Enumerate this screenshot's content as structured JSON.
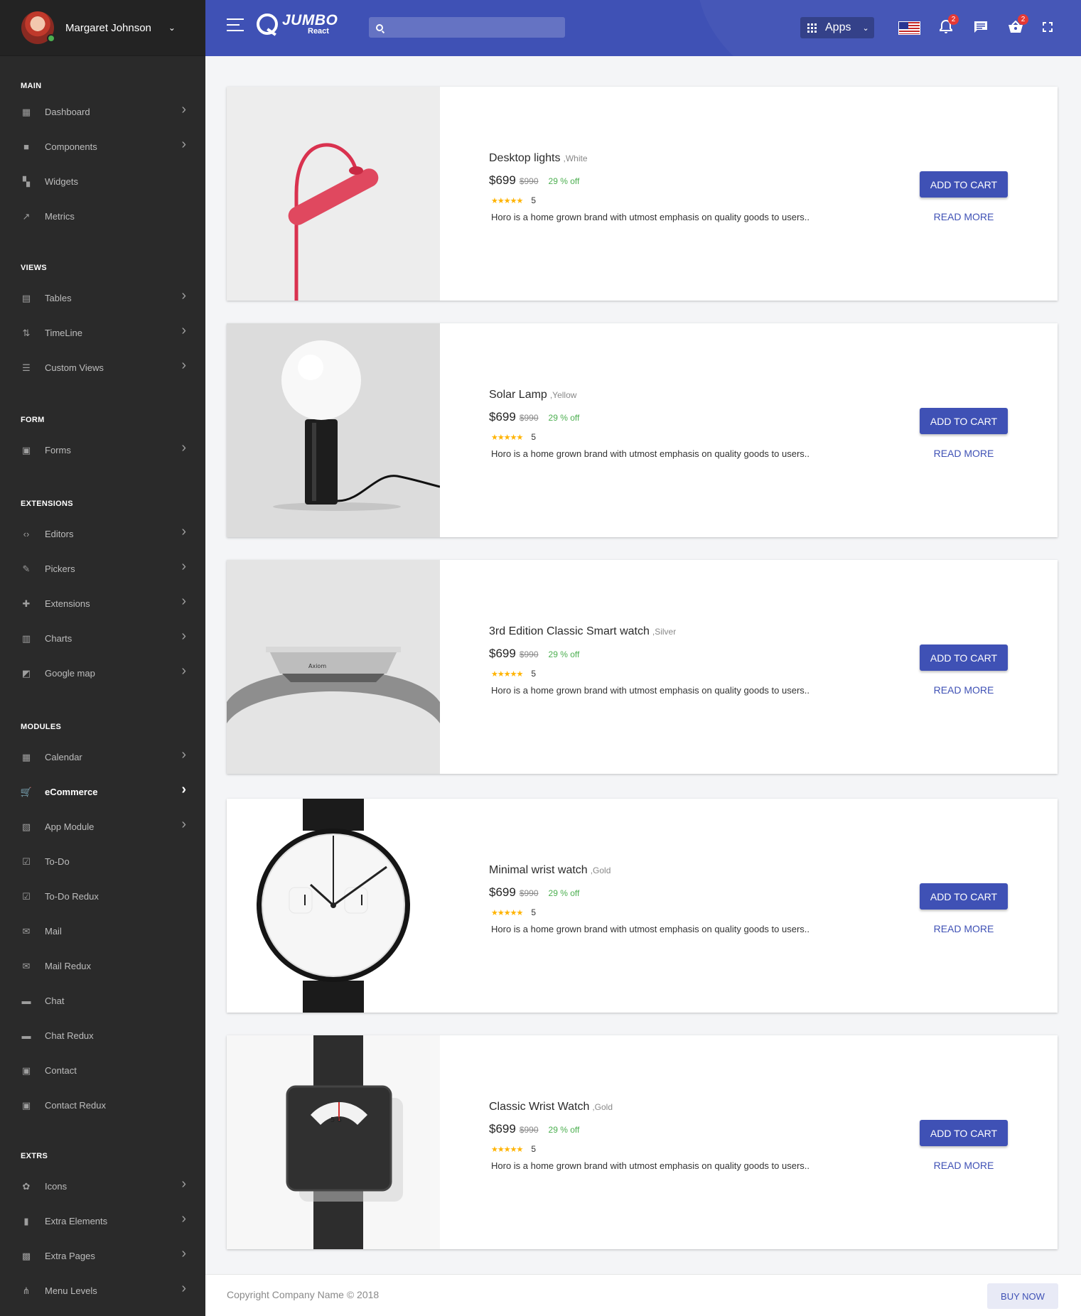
{
  "user": {
    "name": "Margaret Johnson"
  },
  "brand": {
    "name": "JUMBO",
    "sub": "React"
  },
  "search": {
    "placeholder": ""
  },
  "header": {
    "apps_label": "Apps",
    "notifications_count": "2",
    "cart_count": "2"
  },
  "sidebar": {
    "sections": [
      {
        "title": "MAIN",
        "items": [
          {
            "label": "Dashboard",
            "icon": "dashboard-icon",
            "arrow": true
          },
          {
            "label": "Components",
            "icon": "folder-icon",
            "arrow": true
          },
          {
            "label": "Widgets",
            "icon": "widgets-icon",
            "arrow": false
          },
          {
            "label": "Metrics",
            "icon": "trending-icon",
            "arrow": false
          }
        ]
      },
      {
        "title": "VIEWS",
        "items": [
          {
            "label": "Tables",
            "icon": "table-icon",
            "arrow": true
          },
          {
            "label": "TimeLine",
            "icon": "timeline-icon",
            "arrow": true
          },
          {
            "label": "Custom Views",
            "icon": "list-icon",
            "arrow": true
          }
        ]
      },
      {
        "title": "FORM",
        "items": [
          {
            "label": "Forms",
            "icon": "form-icon",
            "arrow": true
          }
        ]
      },
      {
        "title": "EXTENSIONS",
        "items": [
          {
            "label": "Editors",
            "icon": "code-icon",
            "arrow": true
          },
          {
            "label": "Pickers",
            "icon": "brush-icon",
            "arrow": true
          },
          {
            "label": "Extensions",
            "icon": "puzzle-icon",
            "arrow": true
          },
          {
            "label": "Charts",
            "icon": "chart-icon",
            "arrow": true
          },
          {
            "label": "Google map",
            "icon": "map-icon",
            "arrow": true
          }
        ]
      },
      {
        "title": "MODULES",
        "items": [
          {
            "label": "Calendar",
            "icon": "calendar-icon",
            "arrow": true
          },
          {
            "label": "eCommerce",
            "icon": "cart-icon",
            "arrow": true,
            "active": true
          },
          {
            "label": "App Module",
            "icon": "app-module-icon",
            "arrow": true
          },
          {
            "label": "To-Do",
            "icon": "checkbox-icon",
            "arrow": false
          },
          {
            "label": "To-Do Redux",
            "icon": "checkbox-icon",
            "arrow": false
          },
          {
            "label": "Mail",
            "icon": "mail-icon",
            "arrow": false
          },
          {
            "label": "Mail Redux",
            "icon": "mail-icon",
            "arrow": false
          },
          {
            "label": "Chat",
            "icon": "chat-icon",
            "arrow": false
          },
          {
            "label": "Chat Redux",
            "icon": "chat-icon",
            "arrow": false
          },
          {
            "label": "Contact",
            "icon": "contact-icon",
            "arrow": false
          },
          {
            "label": "Contact Redux",
            "icon": "contact-icon",
            "arrow": false
          }
        ]
      },
      {
        "title": "EXTRS",
        "items": [
          {
            "label": "Icons",
            "icon": "icons-icon",
            "arrow": true
          },
          {
            "label": "Extra Elements",
            "icon": "elements-icon",
            "arrow": true
          },
          {
            "label": "Extra Pages",
            "icon": "pages-icon",
            "arrow": true
          },
          {
            "label": "Menu Levels",
            "icon": "menu-levels-icon",
            "arrow": true
          }
        ]
      }
    ]
  },
  "products": [
    {
      "name": "Desktop lights",
      "variant": ",White",
      "price": "$699",
      "old_price": "$990",
      "discount": "29 % off",
      "stars": "★★★★★",
      "rating": "5",
      "description": "Horo is a home grown brand with utmost emphasis on quality goods to users..",
      "image": "desk-lamp",
      "add_label": "ADD TO CART",
      "read_label": "READ MORE"
    },
    {
      "name": "Solar Lamp",
      "variant": ",Yellow",
      "price": "$699",
      "old_price": "$990",
      "discount": "29 % off",
      "stars": "★★★★★",
      "rating": "5",
      "description": "Horo is a home grown brand with utmost emphasis on quality goods to users..",
      "image": "solar-lamp",
      "add_label": "ADD TO CART",
      "read_label": "READ MORE"
    },
    {
      "name": "3rd Edition Classic Smart watch",
      "variant": ",Silver",
      "price": "$699",
      "old_price": "$990",
      "discount": "29 % off",
      "stars": "★★★★★",
      "rating": "5",
      "description": "Horo is a home grown brand with utmost emphasis on quality goods to users..",
      "image": "smart-watch",
      "add_label": "ADD TO CART",
      "read_label": "READ MORE"
    },
    {
      "name": "Minimal wrist watch",
      "variant": ",Gold",
      "price": "$699",
      "old_price": "$990",
      "discount": "29 % off",
      "stars": "★★★★★",
      "rating": "5",
      "description": "Horo is a home grown brand with utmost emphasis on quality goods to users..",
      "image": "minimal-watch",
      "add_label": "ADD TO CART",
      "read_label": "READ MORE"
    },
    {
      "name": "Classic Wrist Watch",
      "variant": ",Gold",
      "price": "$699",
      "old_price": "$990",
      "discount": "29 % off",
      "stars": "★★★★★",
      "rating": "5",
      "description": "Horo is a home grown brand with utmost emphasis on quality goods to users..",
      "image": "classic-watch",
      "add_label": "ADD TO CART",
      "read_label": "READ MORE"
    }
  ],
  "footer": {
    "copyright": "Copyright Company Name © 2018",
    "buy_label": "BUY NOW"
  },
  "colors": {
    "primary": "#3f51b5",
    "sidebar": "#2a2a2a",
    "discount": "#4caf50",
    "star": "#ffb300",
    "badge": "#e53935"
  }
}
